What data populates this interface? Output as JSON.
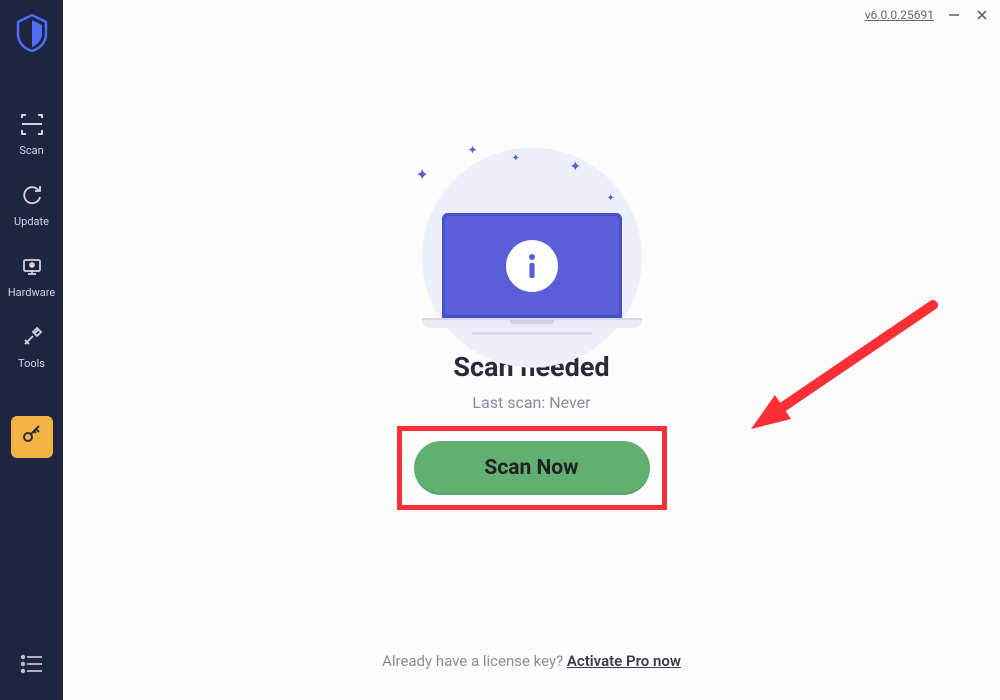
{
  "titlebar": {
    "version": "v6.0.0.25691"
  },
  "sidebar": {
    "items": [
      {
        "id": "scan",
        "label": "Scan"
      },
      {
        "id": "update",
        "label": "Update"
      },
      {
        "id": "hardware",
        "label": "Hardware"
      },
      {
        "id": "tools",
        "label": "Tools"
      }
    ]
  },
  "main": {
    "headline": "Scan needed",
    "last_scan_label": "Last scan: Never",
    "cta_label": "Scan Now"
  },
  "footer": {
    "prompt": "Already have a license key? ",
    "link_label": "Activate Pro now"
  }
}
